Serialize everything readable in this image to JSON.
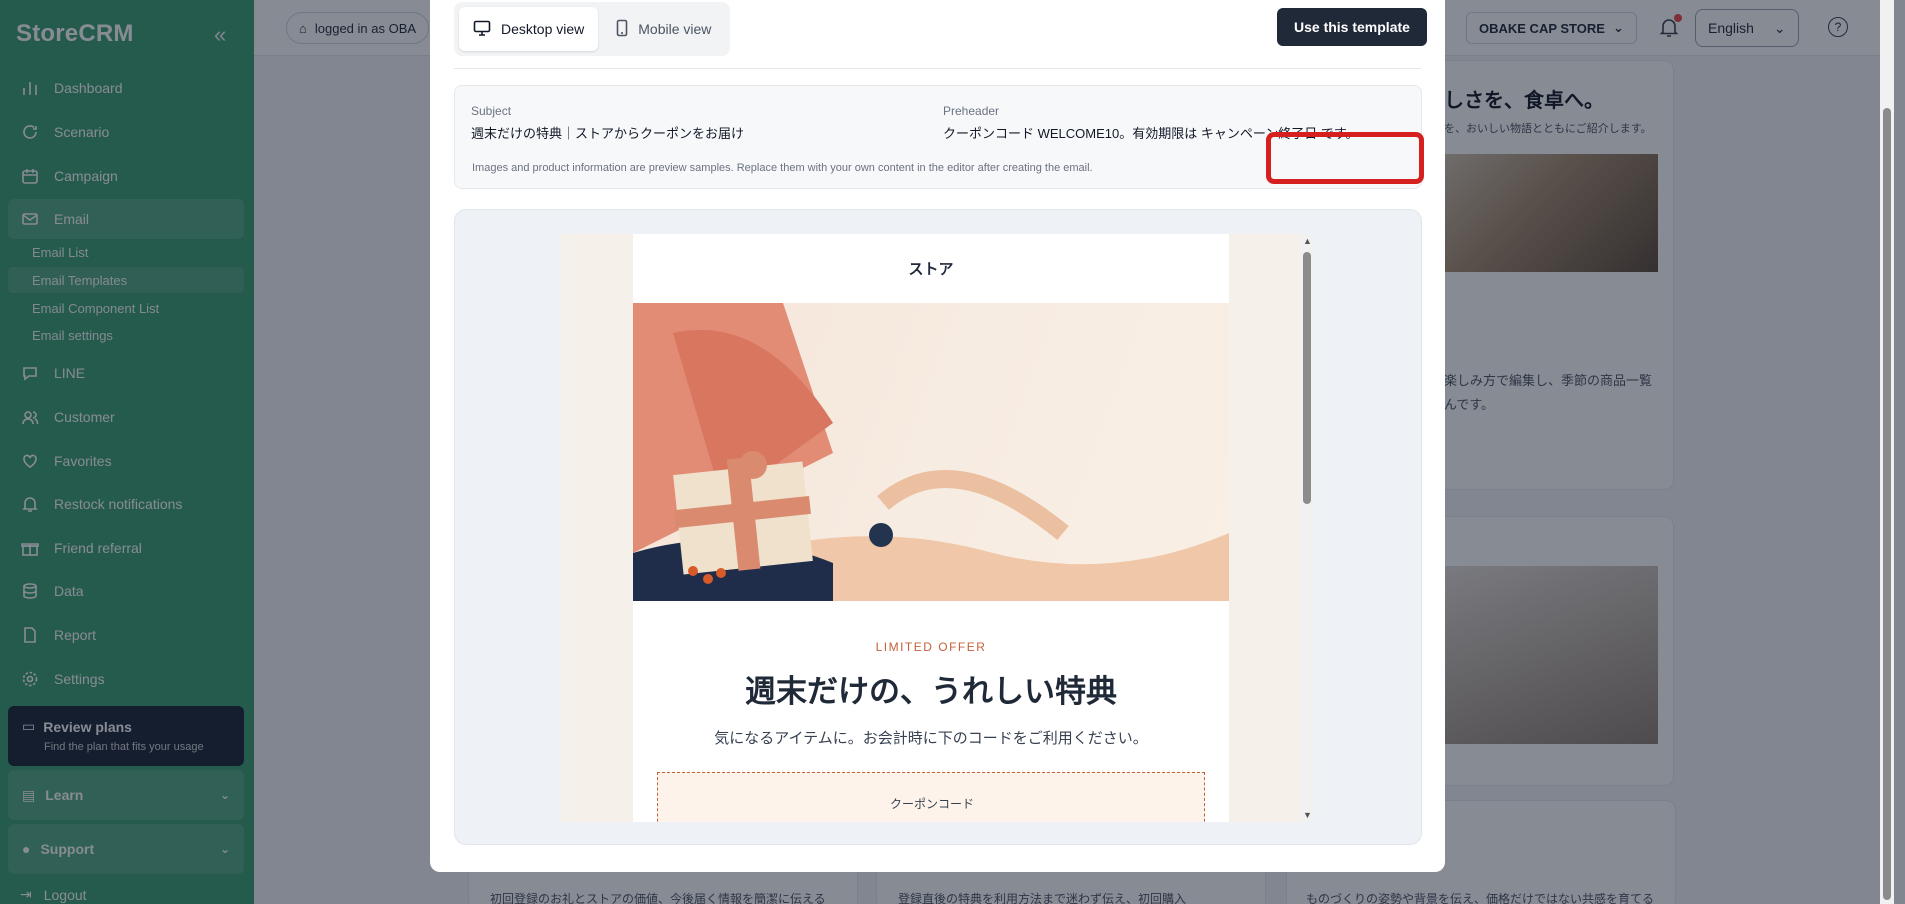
{
  "sidebar": {
    "brand": "StoreCRM",
    "items": [
      {
        "label": "Dashboard",
        "icon": "bar-chart-icon"
      },
      {
        "label": "Scenario",
        "icon": "refresh-icon"
      },
      {
        "label": "Campaign",
        "icon": "calendar-icon"
      },
      {
        "label": "Email",
        "icon": "mail-icon"
      },
      {
        "label": "LINE",
        "icon": "chat-icon"
      },
      {
        "label": "Customer",
        "icon": "users-icon"
      },
      {
        "label": "Favorites",
        "icon": "heart-icon"
      },
      {
        "label": "Restock notifications",
        "icon": "bell-icon"
      },
      {
        "label": "Friend referral",
        "icon": "gift-icon"
      },
      {
        "label": "Data",
        "icon": "database-icon"
      },
      {
        "label": "Report",
        "icon": "file-icon"
      },
      {
        "label": "Settings",
        "icon": "gear-icon"
      }
    ],
    "email_sub": [
      "Email List",
      "Email Templates",
      "Email Component List",
      "Email settings"
    ],
    "plans_title": "Review plans",
    "plans_sub": "Find the plan that fits your usage",
    "learn": "Learn",
    "support": "Support",
    "logout": "Logout"
  },
  "topbar": {
    "logged_in": "logged in as OBA",
    "store": "OBAKE CAP STORE",
    "language": "English"
  },
  "background": {
    "text1": "しさを、食卓へ。",
    "text2": "を、おいしい物語とともにご紹介します。",
    "text3": "楽しみ方で編集し、季節の商品一覧",
    "text4": "んです。",
    "bottom1": "初回登録のお礼とストアの価値、今後届く情報を簡潔に伝える",
    "bottom2": "登録直後の特典を利用方法まで迷わず伝え、初回購入",
    "bottom3": "ものづくりの姿勢や背景を伝え、価格だけではない共感を育てる"
  },
  "modal": {
    "desktop_view": "Desktop view",
    "mobile_view": "Mobile view",
    "use_template": "Use this template",
    "subject_label": "Subject",
    "subject_value": "週末だけの特典｜ストアからクーポンをお届け",
    "preheader_label": "Preheader",
    "preheader_value": "クーポンコード WELCOME10。有効期限は キャンペーン終了日 です。",
    "note": "Images and product information are preview samples. Replace them with your own content in the editor after creating the email."
  },
  "email": {
    "store": "ストア",
    "eyebrow": "LIMITED OFFER",
    "headline": "週末だけの、うれしい特典",
    "lead": "気になるアイテムに。お会計時に下のコードをご利用ください。",
    "coupon_label": "クーポンコード"
  }
}
